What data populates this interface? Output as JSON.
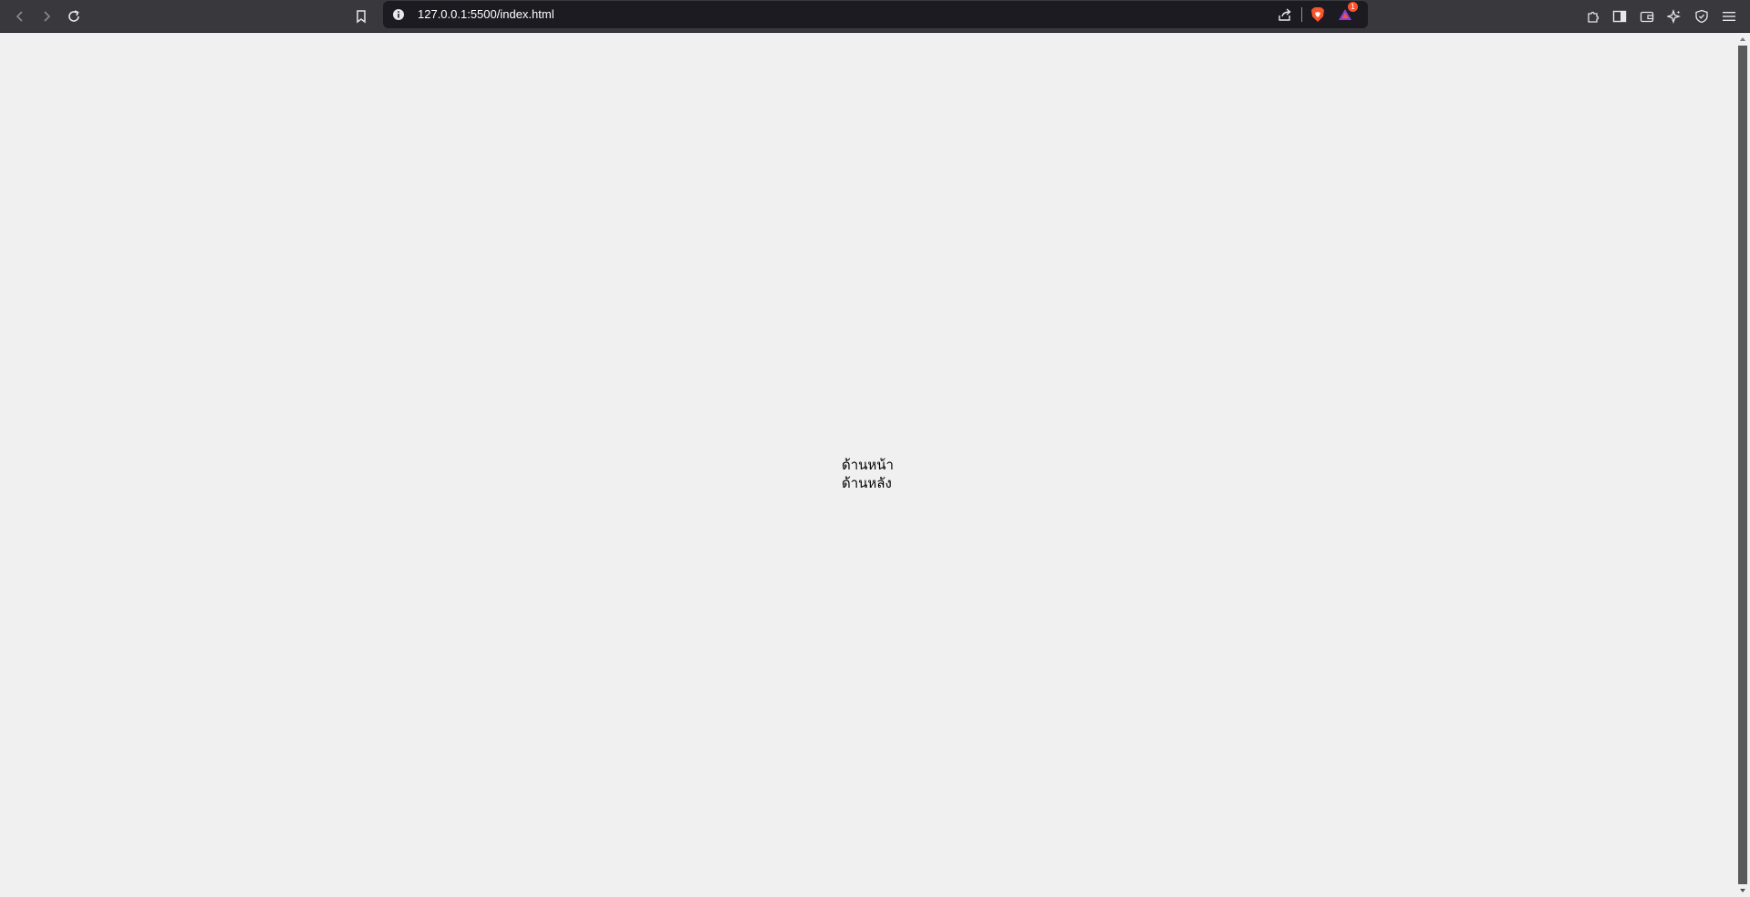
{
  "browser": {
    "url": "127.0.0.1:5500/index.html",
    "notification_count": "1",
    "accent_brave": "#fb542b",
    "toolbar_color": "#38383d",
    "urlbar_color": "#1c1b22"
  },
  "page": {
    "lines": [
      "ด้านหน้า",
      "ด้านหลัง"
    ],
    "background": "#f0f0f0"
  }
}
